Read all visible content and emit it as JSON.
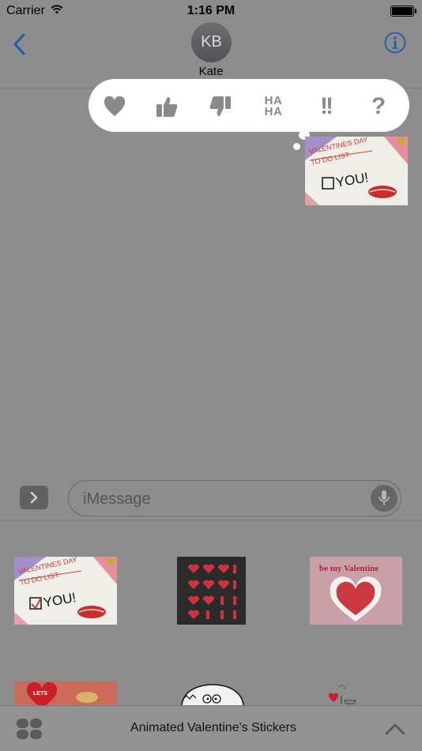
{
  "status_bar": {
    "carrier": "Carrier",
    "time": "1:16 PM"
  },
  "nav": {
    "avatar_initials": "KB",
    "contact_name": "Kate"
  },
  "tapback": {
    "options": [
      "heart",
      "thumbs-up",
      "thumbs-down",
      "HA HA",
      "!!",
      "?"
    ],
    "haha_line1": "HA",
    "haha_line2": "HA",
    "exclaim": "!!",
    "question": "?"
  },
  "message_sticker": {
    "line1": "VALENTINES DAY",
    "line2": "TO DO LIST:",
    "answer": "YOU!"
  },
  "composer": {
    "placeholder": "iMessage"
  },
  "stickers": {
    "s1": {
      "line1": "VALENTINES DAY",
      "line2": "TO DO LIST:",
      "answer": "YOU!"
    },
    "s3": {
      "caption": "be my Valentine"
    },
    "s4": {
      "caption": "LETS"
    }
  },
  "bottom_bar": {
    "app_title": "Animated Valentine's Stickers"
  },
  "colors": {
    "accent": "#1f5fa8",
    "background": "#8d8d8d",
    "tapback_icon": "#8a8a8a"
  }
}
